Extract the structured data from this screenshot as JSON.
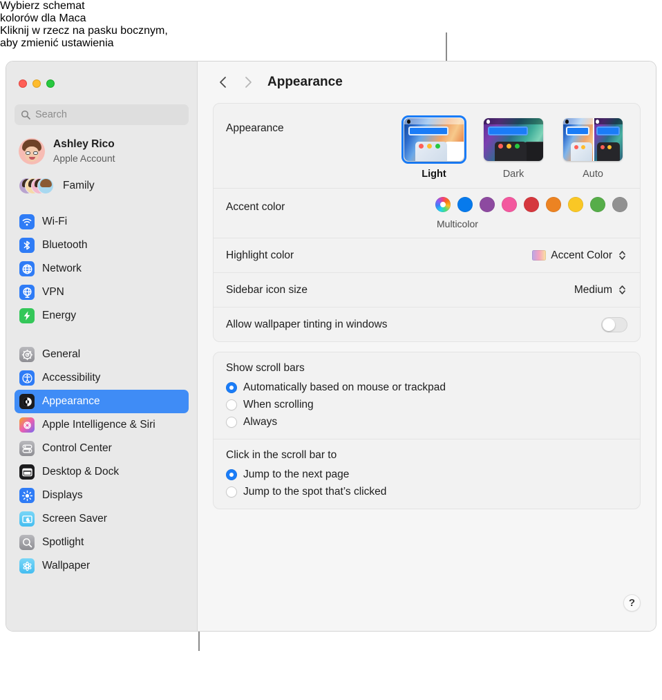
{
  "callouts": {
    "top_line1": "Wybierz schemat",
    "top_line2": "kolorów dla Maca",
    "bottom_line1": "Kliknij w rzecz na pasku bocznym,",
    "bottom_line2": "aby zmienić ustawienia"
  },
  "window": {
    "traffic_lights": [
      "close",
      "minimize",
      "zoom"
    ]
  },
  "sidebar": {
    "search": {
      "placeholder": "Search",
      "value": ""
    },
    "account": {
      "name": "Ashley Rico",
      "subtitle": "Apple Account"
    },
    "family": {
      "label": "Family"
    },
    "group1": [
      {
        "label": "Wi-Fi",
        "icon": "wifi-icon",
        "color": "#2f7cf6"
      },
      {
        "label": "Bluetooth",
        "icon": "bluetooth-icon",
        "color": "#2f7cf6"
      },
      {
        "label": "Network",
        "icon": "globe-icon",
        "color": "#2f7cf6"
      },
      {
        "label": "VPN",
        "icon": "vpn-globe-icon",
        "color": "#2f7cf6"
      },
      {
        "label": "Energy",
        "icon": "bolt-icon",
        "color": "#34c759"
      }
    ],
    "group2": [
      {
        "label": "General",
        "icon": "gear-icon",
        "color": "#9b9b9f",
        "selected": false
      },
      {
        "label": "Accessibility",
        "icon": "accessibility-icon",
        "color": "#2f7cf6",
        "selected": false
      },
      {
        "label": "Appearance",
        "icon": "appearance-icon",
        "color": "#1c1c1e",
        "selected": true
      },
      {
        "label": "Apple Intelligence & Siri",
        "icon": "siri-icon",
        "color": "#e86ab0",
        "selected": false
      },
      {
        "label": "Control Center",
        "icon": "control-center-icon",
        "color": "#9b9b9f",
        "selected": false
      },
      {
        "label": "Desktop & Dock",
        "icon": "desktop-dock-icon",
        "color": "#1c1c1e",
        "selected": false
      },
      {
        "label": "Displays",
        "icon": "displays-icon",
        "color": "#2f7cf6",
        "selected": false
      },
      {
        "label": "Screen Saver",
        "icon": "screen-saver-icon",
        "color": "#5ac8f5",
        "selected": false
      },
      {
        "label": "Spotlight",
        "icon": "spotlight-icon",
        "color": "#9b9b9f",
        "selected": false
      },
      {
        "label": "Wallpaper",
        "icon": "wallpaper-icon",
        "color": "#5ac8f5",
        "selected": false
      }
    ]
  },
  "toolbar": {
    "back": "back-chevron",
    "forward": "forward-chevron",
    "title": "Appearance"
  },
  "main": {
    "appearance": {
      "label": "Appearance",
      "modes": [
        {
          "label": "Light",
          "selected": true
        },
        {
          "label": "Dark",
          "selected": false
        },
        {
          "label": "Auto",
          "selected": false
        }
      ]
    },
    "accent": {
      "label": "Accent color",
      "caption": "Multicolor",
      "swatches": [
        {
          "name": "Multicolor",
          "color": "multicolor",
          "selected": true
        },
        {
          "name": "Blue",
          "color": "#077aec"
        },
        {
          "name": "Purple",
          "color": "#8d4aa0"
        },
        {
          "name": "Pink",
          "color": "#f3589e"
        },
        {
          "name": "Red",
          "color": "#d5373e"
        },
        {
          "name": "Orange",
          "color": "#ec8322"
        },
        {
          "name": "Yellow",
          "color": "#f9c725"
        },
        {
          "name": "Green",
          "color": "#56ad49"
        },
        {
          "name": "Graphite",
          "color": "#919191"
        }
      ]
    },
    "highlight": {
      "label": "Highlight color",
      "value": "Accent Color"
    },
    "sidebar_icon_size": {
      "label": "Sidebar icon size",
      "value": "Medium"
    },
    "wallpaper_tinting": {
      "label": "Allow wallpaper tinting in windows",
      "on": false
    },
    "scroll_bars": {
      "title": "Show scroll bars",
      "options": [
        {
          "label": "Automatically based on mouse or trackpad",
          "selected": true
        },
        {
          "label": "When scrolling",
          "selected": false
        },
        {
          "label": "Always",
          "selected": false
        }
      ]
    },
    "click_scroll_bar": {
      "title": "Click in the scroll bar to",
      "options": [
        {
          "label": "Jump to the next page",
          "selected": true
        },
        {
          "label": "Jump to the spot that’s clicked",
          "selected": false
        }
      ]
    },
    "help": {
      "label": "?"
    }
  }
}
